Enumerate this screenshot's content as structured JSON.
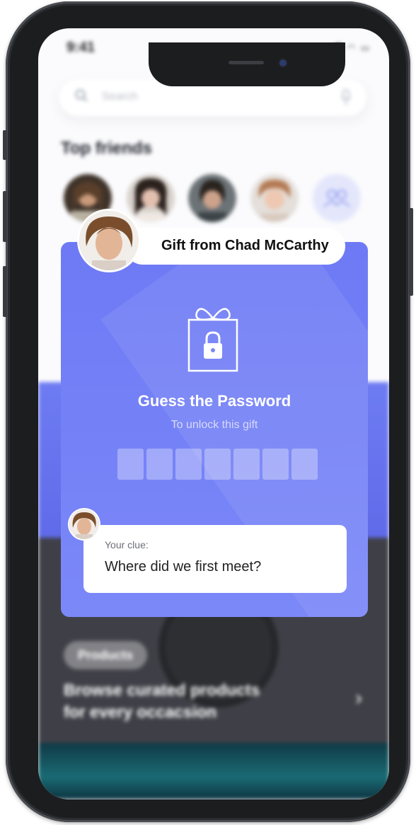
{
  "status_bar": {
    "time": "9:41"
  },
  "search": {
    "placeholder": "Search"
  },
  "top_friends": {
    "title": "Top friends"
  },
  "gift": {
    "prefix": "Gift from ",
    "sender": "Chad McCarthy",
    "title": "Guess the Password",
    "subtitle": "To unlock this gift",
    "password_length": 7
  },
  "clue": {
    "label": "Your clue:",
    "text": "Where did we first meet?"
  },
  "products": {
    "tag": "Products",
    "line1": "Browse curated products",
    "line2": "for every occacsion"
  },
  "colors": {
    "modal": "#7580f6",
    "accent": "#6e7af5"
  }
}
